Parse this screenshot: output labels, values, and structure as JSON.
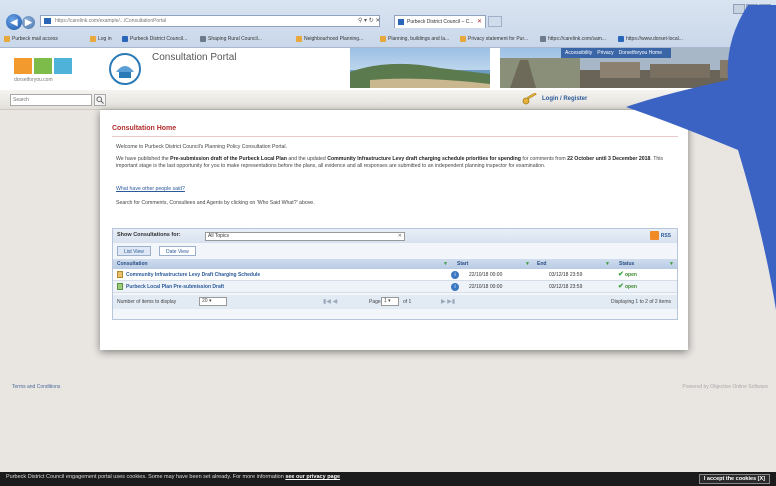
{
  "browser": {
    "address": "https://carelink.com/example/.../ConsultationPortal",
    "tab_title": "Purbeck District Council – C...",
    "bookmarks": [
      "Purbeck mail access",
      "Log in",
      "Purbeck District Council...",
      "Shaping Rural Council...",
      "Neighbourhood Planning...",
      "Planning, buildings and la...",
      "Privacy statement for Pur...",
      "https://carelink.com/sam...",
      "https://www.dorset-local..."
    ]
  },
  "site": {
    "logo_text": "dorsetforyou.com",
    "portal_title": "Consultation Portal",
    "top_links": [
      "Accessibility",
      "Privacy",
      "Dorsetforyou Home"
    ],
    "search_placeholder": "Search",
    "login_label": "Login / Register"
  },
  "main": {
    "heading": "Consultation Home",
    "welcome": "Welcome to Purbeck District Council's Planning Policy Consultation Portal.",
    "intro_pre": "We have published the ",
    "intro_doc1": "Pre-submission draft of the Purbeck Local Plan",
    "intro_mid1": " and the updated ",
    "intro_doc2": "Community Infrastructure Levy draft charging schedule priorities for spending",
    "intro_mid2": " for comments from ",
    "intro_dates": "22 October until 3 December 2018",
    "intro_post": ". This important stage is the last opportunity for you to make representations before the plans, all evidence and all responses are submitted to an independent planning inspector for examination.",
    "others_link": "What have other people said?",
    "search_hint": "Search for Comments, Consultees and Agents by clicking on 'Who Said What?' above."
  },
  "widget": {
    "show_label": "Show Consultations for:",
    "topic_value": "All Topics",
    "rss_label": "RSS",
    "tabs": [
      "List View",
      "Date View"
    ],
    "columns": [
      "Consultation",
      "Start",
      "End",
      "Status"
    ],
    "rows": [
      {
        "title": "Community Infrastructure Levy Draft Charging Schedule",
        "start": "22/10/18 00:00",
        "end": "03/12/18 23:59",
        "status": "open"
      },
      {
        "title": "Purbeck Local Plan Pre-submission Draft",
        "start": "22/10/18 00:00",
        "end": "03/12/18 23:59",
        "status": "open"
      }
    ],
    "pager": {
      "items_label": "Number of items to display",
      "items_value": "20",
      "page_label": "Page",
      "page_value": "1",
      "of_label": "of 1",
      "display_text": "Displaying 1 to 2 of 2 items"
    }
  },
  "footer": {
    "left": "Terms and Conditions",
    "right": "Powered by Objective Online Software"
  },
  "cookie": {
    "text": "Purbeck District Council engagement portal uses cookies. Some may have been set already. For more information ",
    "link": "see our privacy page",
    "button": "I accept the cookies [X]"
  },
  "colors": {
    "accent_blue": "#3b63c4",
    "heading_red": "#b22c2c",
    "link_blue": "#2a5a9a",
    "status_green": "#3a8a2a"
  }
}
